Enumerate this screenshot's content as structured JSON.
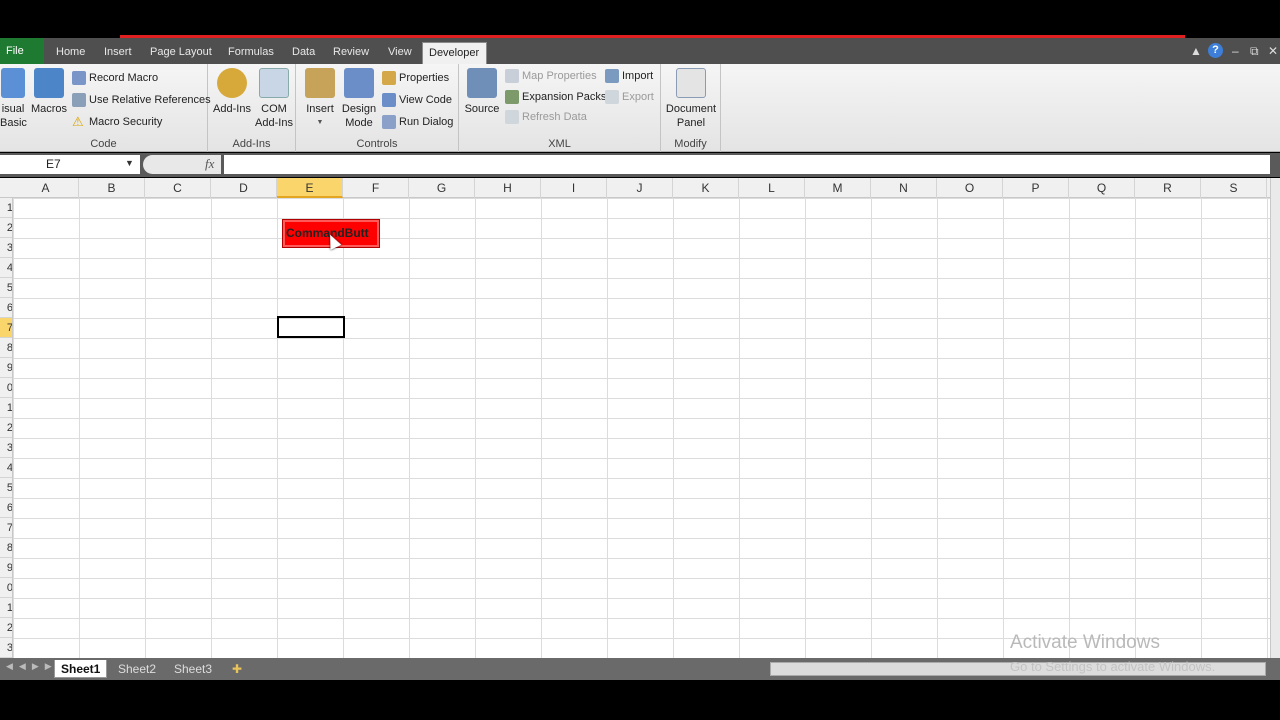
{
  "ribbon_tabs": {
    "file": "File",
    "home": "Home",
    "insert": "Insert",
    "page_layout": "Page Layout",
    "formulas": "Formulas",
    "data": "Data",
    "review": "Review",
    "view": "View",
    "developer": "Developer"
  },
  "window_controls": {
    "help": "?",
    "minimize": "–",
    "restore": "⧉",
    "close": "✕"
  },
  "code_group": {
    "label": "Code",
    "visual_basic_line1": "isual",
    "visual_basic_line2": "Basic",
    "macros": "Macros",
    "record_macro": "Record Macro",
    "use_relative": "Use Relative References",
    "macro_security": "Macro Security"
  },
  "addins_group": {
    "label": "Add-Ins",
    "add_ins": "Add-Ins",
    "com_line1": "COM",
    "com_line2": "Add-Ins"
  },
  "controls_group": {
    "label": "Controls",
    "insert": "Insert",
    "design_line1": "Design",
    "design_line2": "Mode",
    "properties": "Properties",
    "view_code": "View Code",
    "run_dialog": "Run Dialog"
  },
  "xml_group": {
    "label": "XML",
    "source": "Source",
    "map_properties": "Map Properties",
    "expansion_packs": "Expansion Packs",
    "refresh_data": "Refresh Data",
    "import": "Import",
    "export": "Export"
  },
  "modify_group": {
    "label": "Modify",
    "doc_line1": "Document",
    "doc_line2": "Panel"
  },
  "formula_bar": {
    "name_box": "E7",
    "fx": "fx",
    "value": ""
  },
  "columns": [
    "A",
    "B",
    "C",
    "D",
    "E",
    "F",
    "G",
    "H",
    "I",
    "J",
    "K",
    "L",
    "M",
    "N",
    "O",
    "P",
    "Q",
    "R",
    "S"
  ],
  "selected_column": "E",
  "rows": [
    "1",
    "2",
    "3",
    "4",
    "5",
    "6",
    "7",
    "8",
    "9",
    "0",
    "1",
    "2",
    "3",
    "4",
    "5",
    "6",
    "7",
    "8",
    "9",
    "0",
    "1",
    "2",
    "3"
  ],
  "selected_row_index": 6,
  "command_button": {
    "label": "CommandButt",
    "color": "#ff0000"
  },
  "sheets": {
    "sheet1": "Sheet1",
    "sheet2": "Sheet2",
    "sheet3": "Sheet3"
  },
  "watermark": {
    "title": "Activate Windows",
    "subtitle": "Go to Settings to activate Windows."
  }
}
